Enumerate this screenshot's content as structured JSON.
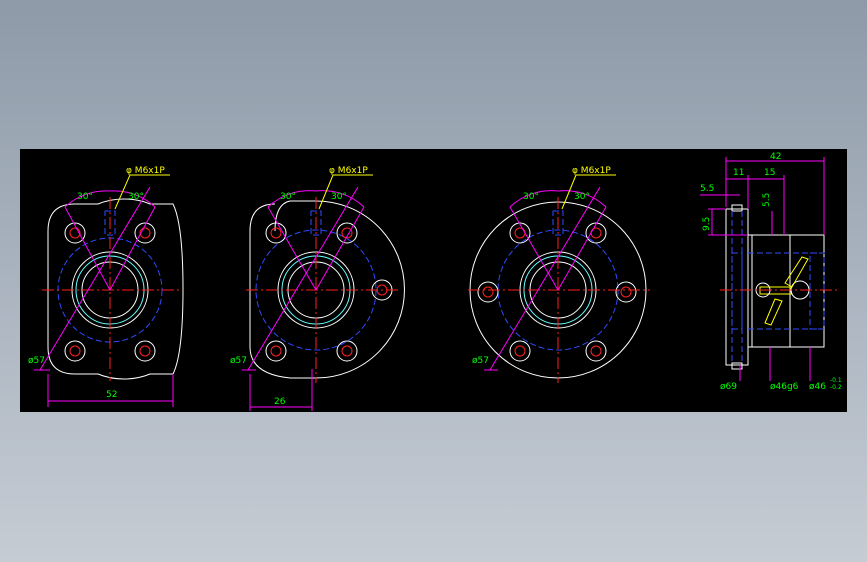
{
  "drawing": {
    "views": [
      {
        "thread_label": "φ M6x1P",
        "angle_left": "30°",
        "angle_right": "30°",
        "diameter_label": "ø57",
        "width_label": "52"
      },
      {
        "thread_label": "φ M6x1P",
        "angle_left": "30°",
        "angle_right": "30°",
        "diameter_label": "ø57",
        "width_label": "26"
      },
      {
        "thread_label": "φ M6x1P",
        "angle_left": "30°",
        "angle_right": "30°",
        "diameter_label": "ø57"
      },
      {
        "overall_length": "42",
        "dim_11": "11",
        "dim_15": "15",
        "dim_5_5_top": "5.5",
        "dim_5_5_side": "5.5",
        "dim_9_5": "9.5",
        "dia_flange": "ø69",
        "dia_body": "ø46g6",
        "dia_tol_main": "ø46",
        "dia_tol_upper": "-0.1",
        "dia_tol_lower": "-0.2"
      }
    ],
    "colors": {
      "outline": "#ffffff",
      "hidden": "#2f4bff",
      "center": "#ff2020",
      "dimension": "#ff00ff",
      "dimension_text": "#00ff00",
      "annotation": "#ffff00"
    }
  }
}
